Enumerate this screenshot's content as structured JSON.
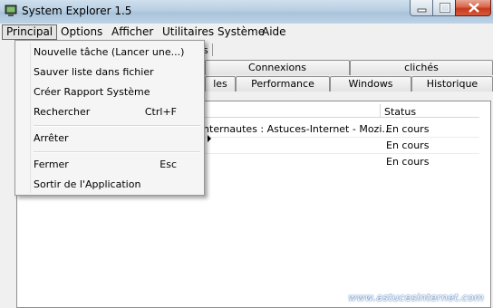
{
  "window": {
    "title": "System Explorer 1.5"
  },
  "menubar": [
    {
      "label": "Principal"
    },
    {
      "label": "Options"
    },
    {
      "label": "Afficher"
    },
    {
      "label": "Utilitaires Système"
    },
    {
      "label": "Aide"
    }
  ],
  "dropdown": {
    "items": [
      {
        "label": "Nouvelle tâche (Lancer une...)",
        "shortcut": ""
      },
      {
        "label": "Sauver liste dans fichier",
        "shortcut": ""
      },
      {
        "label": "Créer Rapport Système",
        "shortcut": ""
      },
      {
        "label": "Rechercher",
        "shortcut": "Ctrl+F"
      },
      {
        "label": "Arrêter",
        "shortcut": ""
      },
      {
        "label": "Fermer",
        "shortcut": "Esc"
      },
      {
        "label": "Sortir de l'Application",
        "shortcut": ""
      }
    ]
  },
  "toolbar_fragment": "s",
  "tabs": {
    "row1": [
      {
        "label": "Connexions"
      },
      {
        "label": "clichés"
      }
    ],
    "row2": [
      {
        "label": "les"
      },
      {
        "label": "Performance"
      },
      {
        "label": "Windows"
      },
      {
        "label": "Historique"
      }
    ]
  },
  "grid": {
    "status_header": "Status",
    "rows": [
      {
        "name": "internautes : Astuces-Internet - Mozi...",
        "status": "En cours"
      },
      {
        "name": "",
        "status": "En cours"
      },
      {
        "name": "",
        "status": "En cours"
      }
    ]
  },
  "watermark": "www.astucesinternet.com"
}
